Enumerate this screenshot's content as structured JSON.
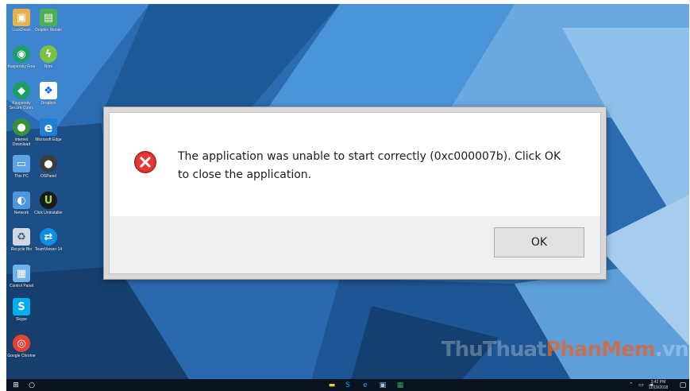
{
  "dialog": {
    "message_line1": "The application was unable to start correctly (0xc000007b). Click OK",
    "message_line2": "to close the application.",
    "ok_label": "OK",
    "icon": "error-icon"
  },
  "desktop_icons": [
    {
      "label": "LockDown"
    },
    {
      "label": "Dolphin Webkit"
    },
    {
      "label": "Kaspersky Free"
    },
    {
      "label": "Nitro"
    },
    {
      "label": "Kaspersky Secure Conn."
    },
    {
      "label": "Dropbox"
    },
    {
      "label": "Internet Download"
    },
    {
      "label": "Microsoft Edge"
    },
    {
      "label": "This PC"
    },
    {
      "label": "OSPanel"
    },
    {
      "label": "Network"
    },
    {
      "label": "Click Uninstaller"
    },
    {
      "label": "Recycle Bin"
    },
    {
      "label": "TeamViewer 14"
    },
    {
      "label": "Control Panel"
    },
    {
      "label": "Skype"
    },
    {
      "label": "Google Chrome"
    }
  ],
  "taskbar": {
    "start_icon": "windows-icon",
    "search_icon": "cortana-icon",
    "time": "3:42 PM",
    "date": "11/19/2018"
  },
  "watermark": {
    "part1": "ThuThuat",
    "part2": "PhanMem",
    "part3": ".vn"
  },
  "colors": {
    "error_red": "#d32f2f",
    "wallpaper_blue": "#2f73b6",
    "taskbar": "#0a1220"
  }
}
